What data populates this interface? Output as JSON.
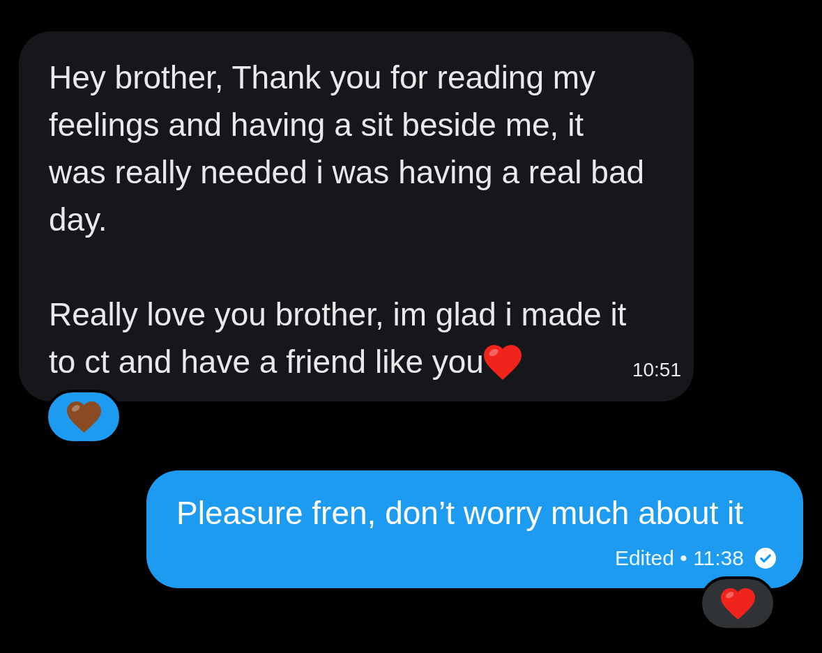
{
  "messages": [
    {
      "kind": "received",
      "paragraphs": [
        "Hey brother, Thank you for reading my feelings and having a sit beside me, it was really needed i was having a real bad day.",
        "Really love you brother, im glad i made it to ct and have a friend like you"
      ],
      "heart_after_text": true,
      "timestamp": "10:51",
      "reaction": {
        "color": "#8a4b22",
        "by_me": true
      }
    },
    {
      "kind": "sent",
      "paragraphs": [
        "Pleasure fren, don’t worry much about it"
      ],
      "timestamp": "Edited • 11:38",
      "read": true,
      "reaction": {
        "color": "#f0231d",
        "by_me": false
      }
    }
  ]
}
